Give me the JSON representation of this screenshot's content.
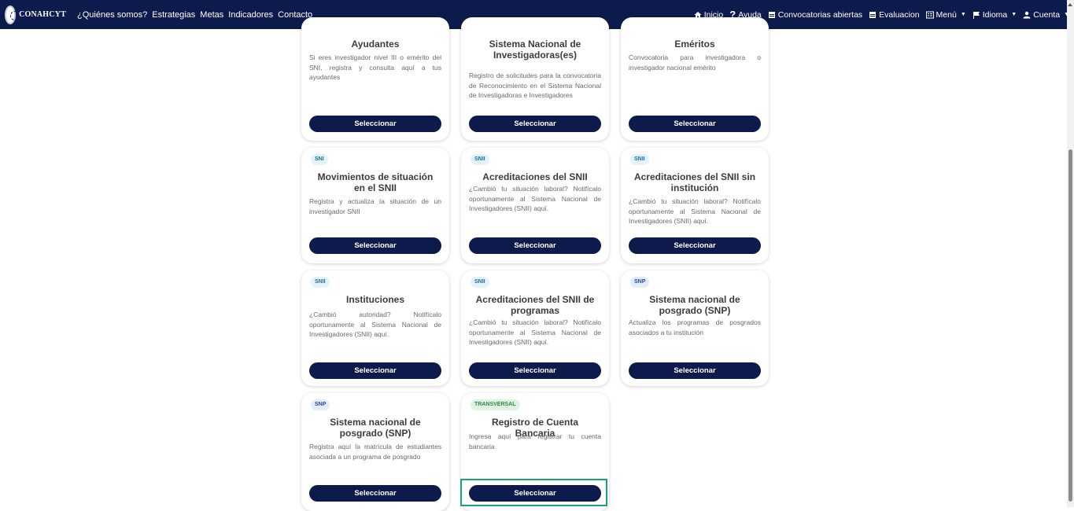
{
  "nav": {
    "brand": "CONAHCYT",
    "links": [
      "¿Quiénes somos?",
      "Estrategias",
      "Metas",
      "Indicadores",
      "Contacto"
    ],
    "right": {
      "inicio": "Inicio",
      "ayuda": "Ayuda",
      "convocatorias": "Convocatorias abiertas",
      "evaluacion": "Evaluacion",
      "menu": "Menú",
      "idioma": "Idioma",
      "cuenta": "Cuenta"
    }
  },
  "button_label": "Seleccionar",
  "cards": [
    {
      "badge": "",
      "title": "Ayudantes",
      "desc": "Si eres investigador nivel III o emérito del SNI, registra y consulta aquí a tus ayudantes"
    },
    {
      "badge": "",
      "title": "Sistema Nacional de Investigadoras(es)",
      "desc": "Registro de solicitudes para la convocatoria de Reconocimiento en el Sistema Nacional de Investigadoras e Investigadores"
    },
    {
      "badge": "",
      "title": "Eméritos",
      "desc": "Convocatoria para investigadora o investigador nacional emérito"
    },
    {
      "badge": "SNI",
      "title": "Movimientos de situación en el SNII",
      "desc": "Registra y actualiza la situación de un investigador SNII"
    },
    {
      "badge": "SNII",
      "title": "Acreditaciones del SNII",
      "desc": "¿Cambió tu situación laboral? Notifícalo oportunamente al Sistema Nacional de Investigadores (SNII) aquí."
    },
    {
      "badge": "SNII",
      "title": "Acreditaciones del SNII sin institución",
      "desc": "¿Cambió tu situación laboral? Notifícalo oportunamente al Sistema Nacional de Investigadores (SNII) aquí."
    },
    {
      "badge": "SNII",
      "title": "Instituciones",
      "desc": "¿Cambió autoridad? Notifícalo oportunamente al Sistema Nacional de Investigadores (SNII) aquí."
    },
    {
      "badge": "SNII",
      "title": "Acreditaciones del SNII de programas",
      "desc": "¿Cambió tu situación laboral? Notifícalo oportunamente al Sistema Nacional de Investigadores (SNII) aquí."
    },
    {
      "badge": "SNP",
      "title": "Sistema nacional de posgrado (SNP)",
      "desc": "Actualiza los programas de posgrados asociados a tu institución"
    },
    {
      "badge": "SNP",
      "title": "Sistema nacional de posgrado (SNP)",
      "desc": "Registra aquí la matrícula de estudiantes asociada a un programa de posgrado"
    },
    {
      "badge": "TRANSVERSAL",
      "title": "Registro de Cuenta Bancaria",
      "desc": "Ingresa aquí para registrar tu cuenta bancaria"
    }
  ]
}
